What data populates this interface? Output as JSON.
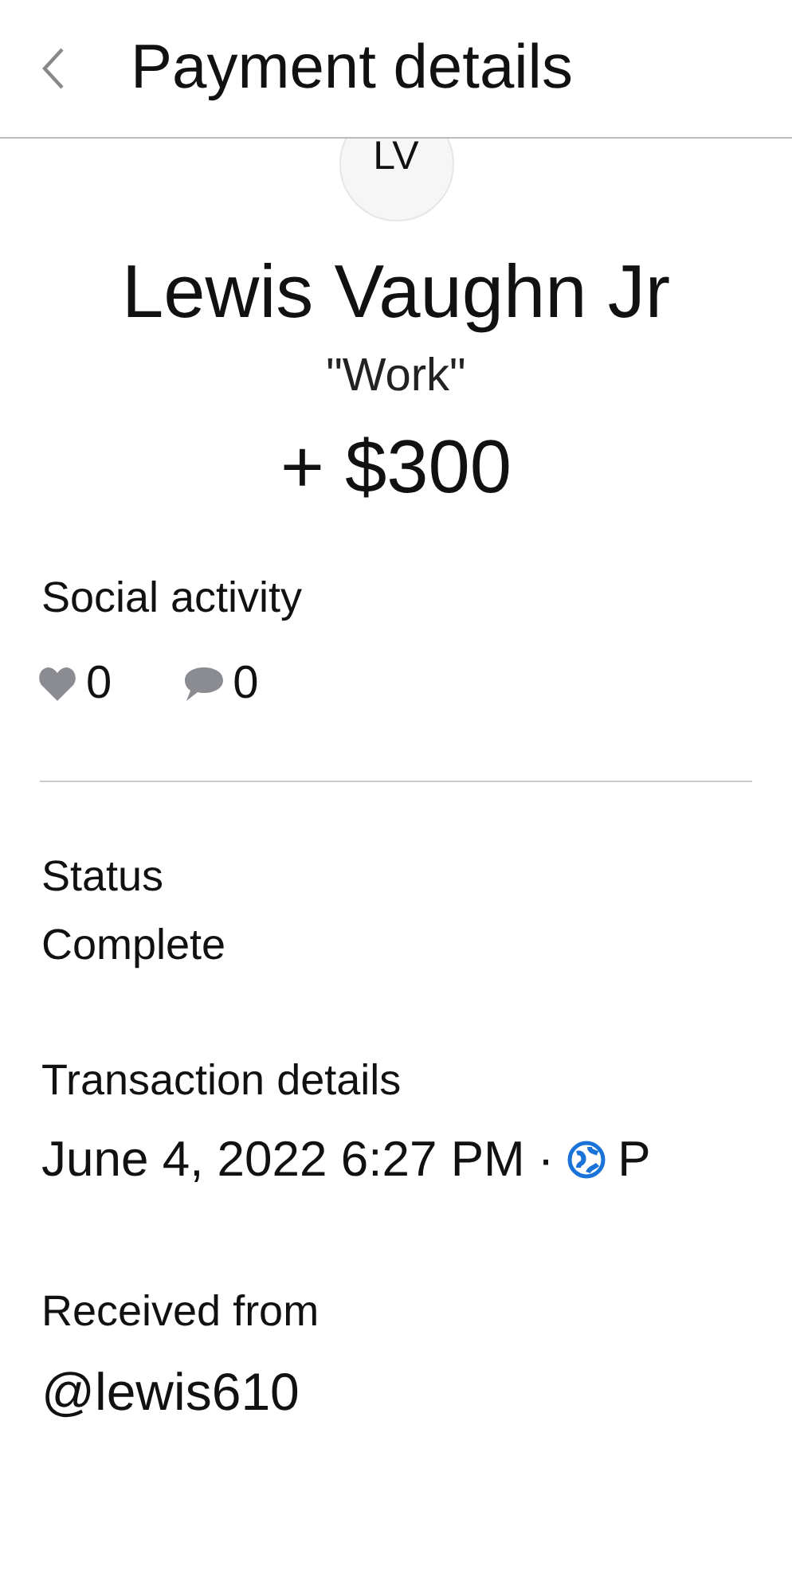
{
  "header": {
    "title": "Payment details"
  },
  "payee": {
    "initials": "LV",
    "name": "Lewis Vaughn Jr",
    "note": "\"Work\"",
    "amount": "+ $300"
  },
  "social": {
    "title": "Social activity",
    "likes": "0",
    "comments": "0"
  },
  "status": {
    "label": "Status",
    "value": "Complete"
  },
  "transaction": {
    "label": "Transaction details",
    "datetime": "June 4, 2022 6:27 PM",
    "separator": "·",
    "audience": "P"
  },
  "received": {
    "label": "Received from",
    "handle": "@lewis610"
  }
}
